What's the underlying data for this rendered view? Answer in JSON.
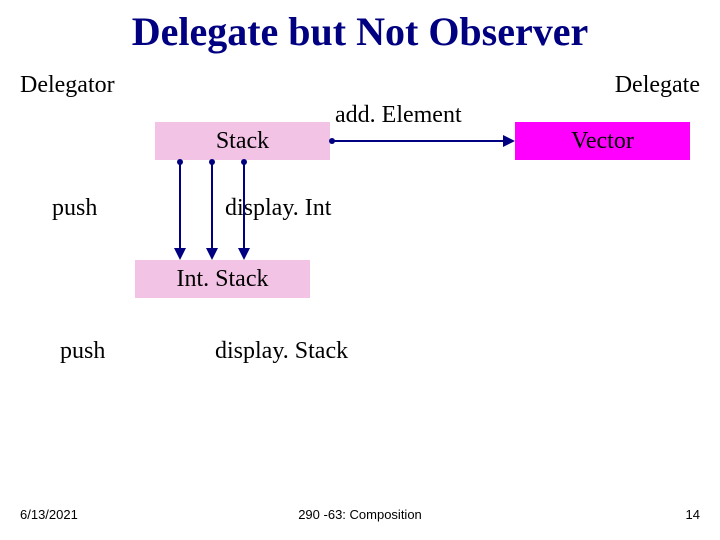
{
  "title": "Delegate but Not Observer",
  "labels": {
    "delegator": "Delegator",
    "delegate": "Delegate",
    "addElement": "add. Element",
    "push1": "push",
    "displayInt": "display. Int",
    "push2": "push",
    "displayStack": "display. Stack"
  },
  "boxes": {
    "stack": "Stack",
    "vector": "Vector",
    "intStack": "Int. Stack"
  },
  "footer": {
    "date": "6/13/2021",
    "center": "290 -63: Composition",
    "page": "14"
  }
}
